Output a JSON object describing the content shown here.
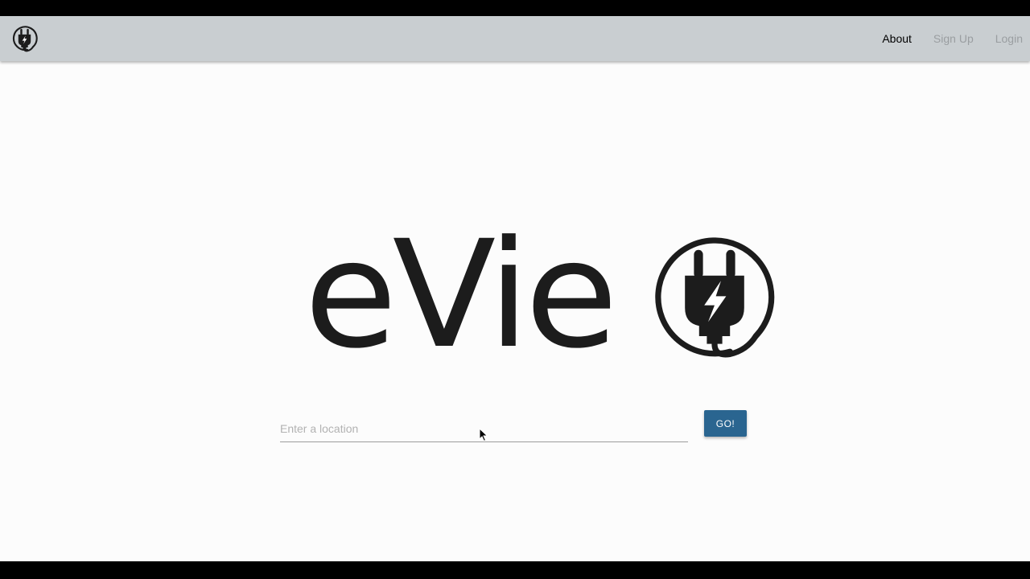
{
  "navbar": {
    "logo_icon": "plug-logo-icon",
    "links": [
      {
        "label": "About",
        "state": "active"
      },
      {
        "label": "Sign Up",
        "state": "muted"
      },
      {
        "label": "Login",
        "state": "muted"
      }
    ]
  },
  "hero": {
    "wordmark": "eVie",
    "logo_icon": "plug-circle-icon"
  },
  "search": {
    "placeholder": "Enter a location",
    "value": "",
    "button_label": "GO!"
  },
  "colors": {
    "navbar_bg": "#c9ced1",
    "page_bg": "#fcfcfc",
    "button_bg": "#2a6590",
    "link_active": "#000000",
    "link_muted": "#9a9ea1",
    "logo_ink": "#1c1c1c"
  }
}
